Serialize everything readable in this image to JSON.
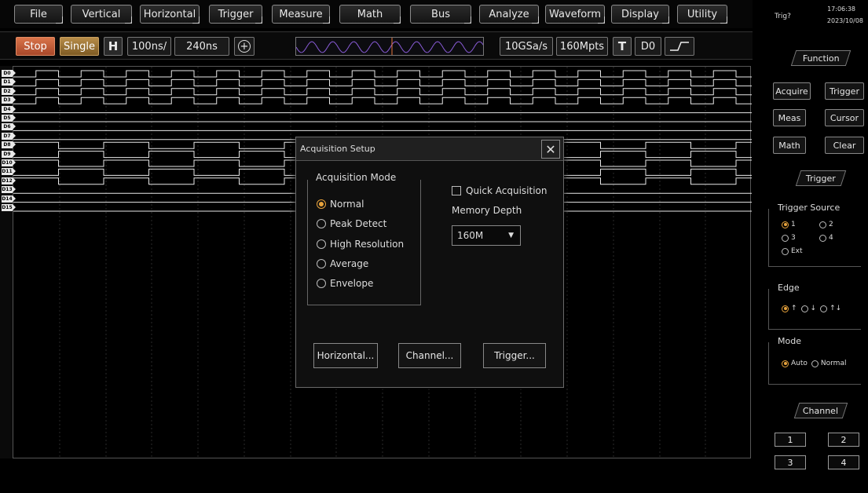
{
  "menu": {
    "items": [
      "File",
      "Vertical",
      "Horizontal",
      "Trigger",
      "Measure",
      "Math",
      "Bus",
      "Analyze",
      "Waveform",
      "Display",
      "Utility"
    ]
  },
  "toolbar": {
    "stop_label": "Stop",
    "single_label": "Single",
    "h_label": "H",
    "timebase": "100ns/",
    "delay": "240ns",
    "sample_rate": "10GSa/s",
    "memory": "160Mpts",
    "t_label": "T",
    "trigger_source": "D0"
  },
  "scope": {
    "channels": [
      "D0",
      "D1",
      "D2",
      "D3",
      "D4",
      "D5",
      "D6",
      "D7",
      "D8",
      "D9",
      "D10",
      "D11",
      "D12",
      "D13",
      "D14",
      "D15"
    ]
  },
  "status": {
    "trig": "Trig?",
    "time": "17:06:38",
    "date": "2023/10/08"
  },
  "right_panel": {
    "function_header": "Function",
    "function_buttons": [
      "Acquire",
      "Trigger",
      "Meas",
      "Cursor",
      "Math",
      "Clear"
    ],
    "trigger_header": "Trigger",
    "trigger_source_title": "Trigger Source",
    "trigger_sources": [
      "1",
      "2",
      "3",
      "4",
      "Ext"
    ],
    "trigger_source_selected": "1",
    "edge_title": "Edge",
    "edge_options": [
      "↑",
      "↓",
      "↑↓"
    ],
    "edge_selected": "↑",
    "mode_title": "Mode",
    "mode_options": [
      "Auto",
      "Normal"
    ],
    "mode_selected": "Auto",
    "channel_header": "Channel",
    "channel_buttons": [
      "1",
      "2",
      "3",
      "4"
    ]
  },
  "dialog": {
    "title": "Acquisition Setup",
    "close_glyph": "✕",
    "acq_mode_title": "Acquisition Mode",
    "acq_modes": [
      "Normal",
      "Peak Detect",
      "High Resolution",
      "Average",
      "Envelope"
    ],
    "acq_mode_selected": "Normal",
    "quick_acq_label": "Quick Acquisition",
    "quick_acq_checked": false,
    "memory_depth_label": "Memory Depth",
    "memory_depth_value": "160M",
    "buttons": [
      "Horizontal...",
      "Channel...",
      "Trigger..."
    ]
  },
  "colors": {
    "accent": "#e8a33c",
    "stop": "#c45a36",
    "single": "#a37736",
    "trace": "#e8e8e8",
    "grid": "#2a2a2a"
  }
}
